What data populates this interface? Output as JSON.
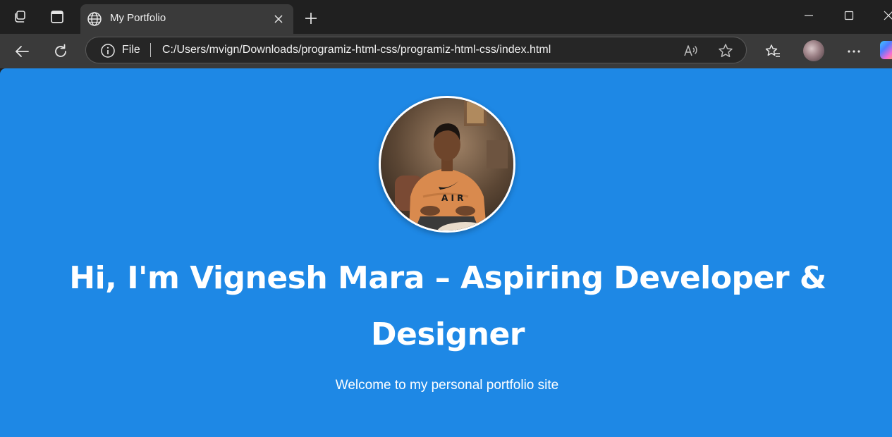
{
  "browser": {
    "tab": {
      "title": "My Portfolio"
    },
    "address_bar": {
      "scheme_label": "File",
      "url": "C:/Users/mvign/Downloads/programiz-html-css/programiz-html-css/index.html"
    },
    "icons": [
      "workspaces-icon",
      "tab-actions-icon",
      "globe-icon",
      "close-icon",
      "plus-icon",
      "minimize-icon",
      "maximize-icon",
      "window-close-icon",
      "back-icon",
      "refresh-icon",
      "info-icon",
      "read-aloud-icon",
      "star-icon",
      "favorites-icon",
      "more-icon",
      "copilot-icon"
    ]
  },
  "page": {
    "background_color": "#1e88e5",
    "heading": "Hi, I'm Vignesh Mara – Aspiring Developer & Designer",
    "subtitle": "Welcome to my personal portfolio site"
  }
}
